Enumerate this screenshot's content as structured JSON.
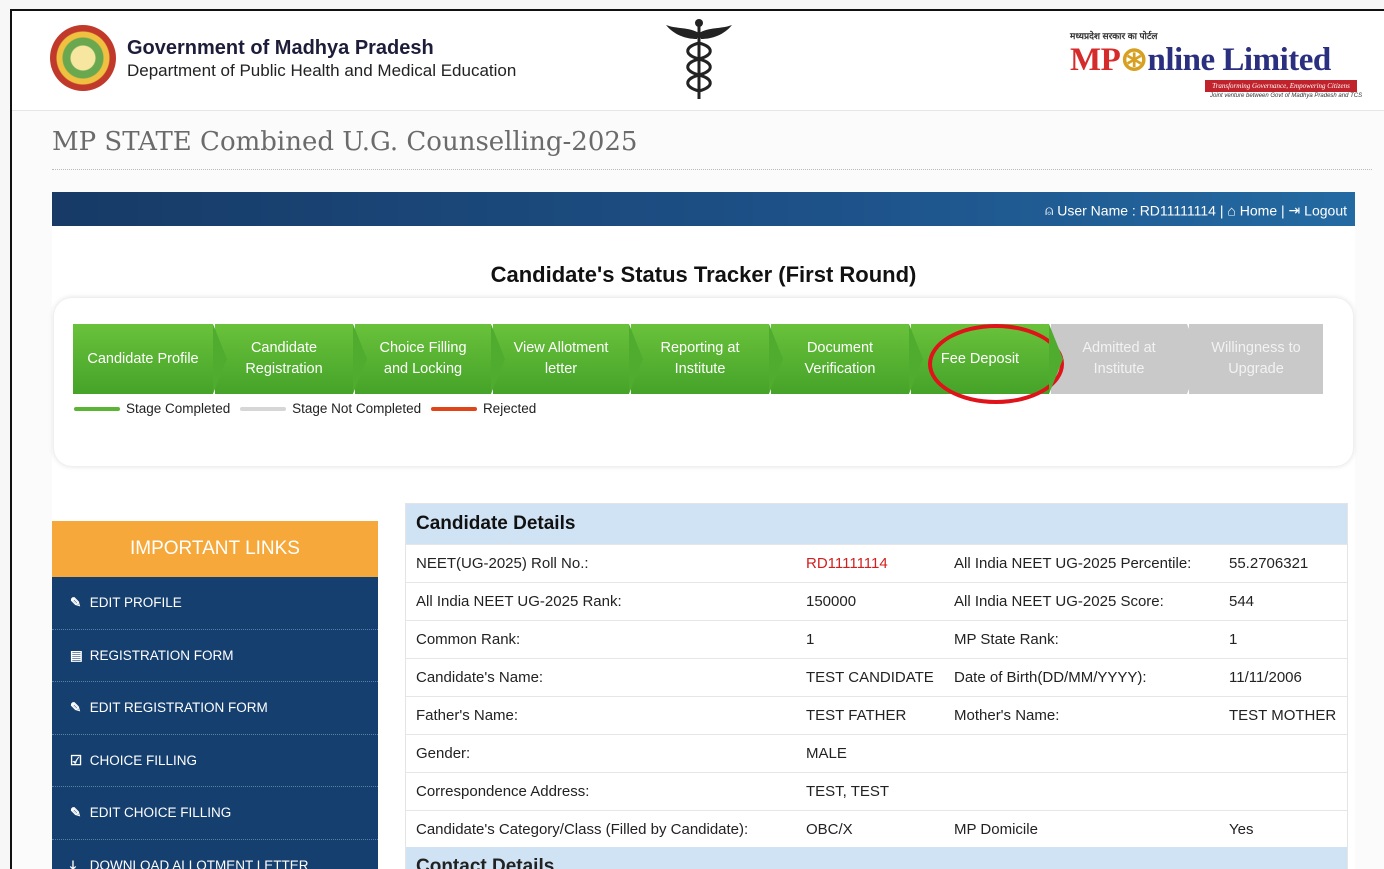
{
  "header": {
    "gov_title": "Government of Madhya Pradesh",
    "gov_subtitle": "Department of Public Health and Medical Education",
    "brand_hindi": "मध्यप्रदेश सरकार का पोर्टल",
    "brand_mp": "MP",
    "brand_rest": "nline Limited",
    "brand_tagline": "Transforming Governance, Empowering Citizens",
    "brand_sub": "Joint venture between Govt of Madhya Pradesh and TCS"
  },
  "page_title": "MP STATE Combined U.G. Counselling-2025",
  "userbar": {
    "user_label": "User Name : RD11111114",
    "home_label": "Home",
    "logout_label": "Logout"
  },
  "tracker": {
    "title": "Candidate's Status Tracker (First Round)",
    "steps": [
      {
        "label": "Candidate Profile",
        "status": "completed"
      },
      {
        "label": "Candidate Registration",
        "status": "completed"
      },
      {
        "label": "Choice Filling and Locking",
        "status": "completed"
      },
      {
        "label": "View Allotment letter",
        "status": "completed"
      },
      {
        "label": "Reporting at Institute",
        "status": "completed"
      },
      {
        "label": "Document Verification",
        "status": "completed"
      },
      {
        "label": "Fee Deposit",
        "status": "completed"
      },
      {
        "label": "Admitted at Institute",
        "status": "not_completed"
      },
      {
        "label": "Willingness to Upgrade",
        "status": "not_completed"
      }
    ],
    "legend": {
      "completed": "Stage Completed",
      "not_completed": "Stage Not Completed",
      "rejected": "Rejected"
    },
    "colors": {
      "completed": "#45a329",
      "not_completed": "#c9c9c9",
      "rejected": "#e0451a",
      "highlight": "#e0121a"
    }
  },
  "sidebar": {
    "heading": "IMPORTANT LINKS",
    "items": [
      {
        "label": "EDIT PROFILE",
        "icon": "edit-icon"
      },
      {
        "label": "REGISTRATION FORM",
        "icon": "form-icon"
      },
      {
        "label": "EDIT REGISTRATION FORM",
        "icon": "edit-icon"
      },
      {
        "label": "CHOICE FILLING",
        "icon": "checkbox-icon"
      },
      {
        "label": "EDIT CHOICE FILLING",
        "icon": "edit-icon"
      },
      {
        "label": "DOWNLOAD ALLOTMENT LETTER",
        "icon": "download-icon"
      }
    ]
  },
  "candidate_details": {
    "heading": "Candidate Details",
    "rows": [
      [
        "NEET(UG-2025) Roll No.:",
        "RD11111114",
        "All India NEET UG-2025 Percentile:",
        "55.2706321"
      ],
      [
        "All India NEET UG-2025 Rank:",
        "150000",
        "All India NEET UG-2025 Score:",
        "544"
      ],
      [
        "Common Rank:",
        "1",
        "MP State Rank:",
        "1"
      ],
      [
        "Candidate's Name:",
        "TEST CANDIDATE",
        "Date of Birth(DD/MM/YYYY):",
        "11/11/2006"
      ],
      [
        "Father's Name:",
        "TEST FATHER",
        "Mother's Name:",
        "TEST MOTHER"
      ],
      [
        "Gender:",
        "MALE",
        "",
        ""
      ],
      [
        "Correspondence Address:",
        "TEST, TEST",
        "",
        ""
      ],
      [
        "Candidate's Category/Class (Filled by Candidate):",
        "OBC/X",
        "MP Domicile",
        "Yes"
      ]
    ]
  },
  "contact_details": {
    "heading": "Contact Details"
  }
}
